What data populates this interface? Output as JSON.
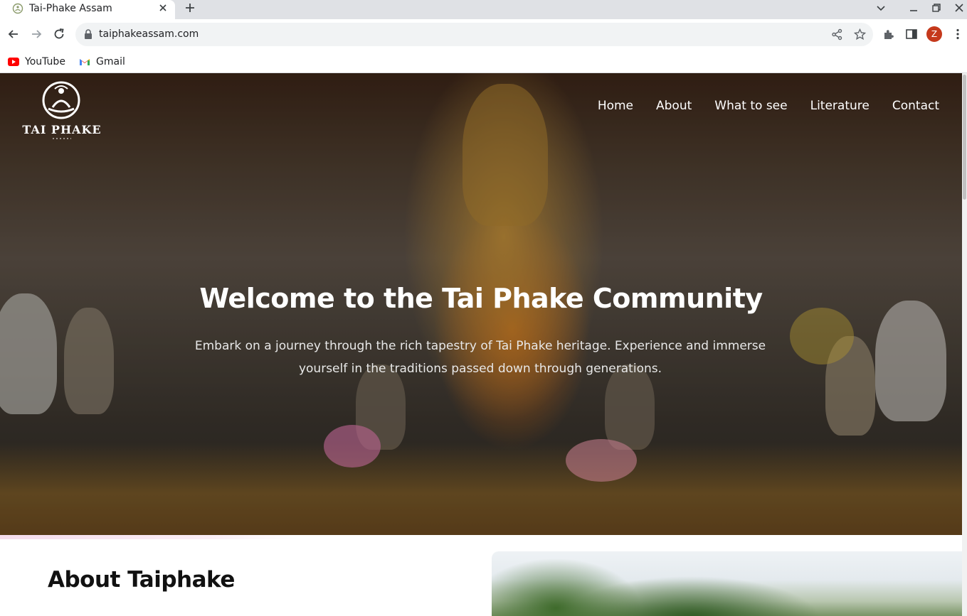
{
  "browser": {
    "tab_title": "Tai-Phake Assam",
    "url": "taiphakeassam.com",
    "profile_initial": "Z",
    "profile_color": "#c5391c",
    "bookmarks": [
      {
        "label": "YouTube",
        "icon": "youtube-icon"
      },
      {
        "label": "Gmail",
        "icon": "gmail-icon"
      }
    ]
  },
  "site": {
    "logo_text": "TAI PHAKE",
    "nav": [
      "Home",
      "About",
      "What to see",
      "Literature",
      "Contact"
    ],
    "hero": {
      "title": "Welcome to the Tai Phake Community",
      "subtitle": "Embark on a journey through the rich tapestry of Tai Phake heritage. Experience and immerse yourself in the traditions passed down through generations."
    },
    "about": {
      "title": "About Taiphake"
    }
  },
  "colors": {
    "accent_divider": "#f5dcec",
    "hero_text": "#ffffff"
  }
}
